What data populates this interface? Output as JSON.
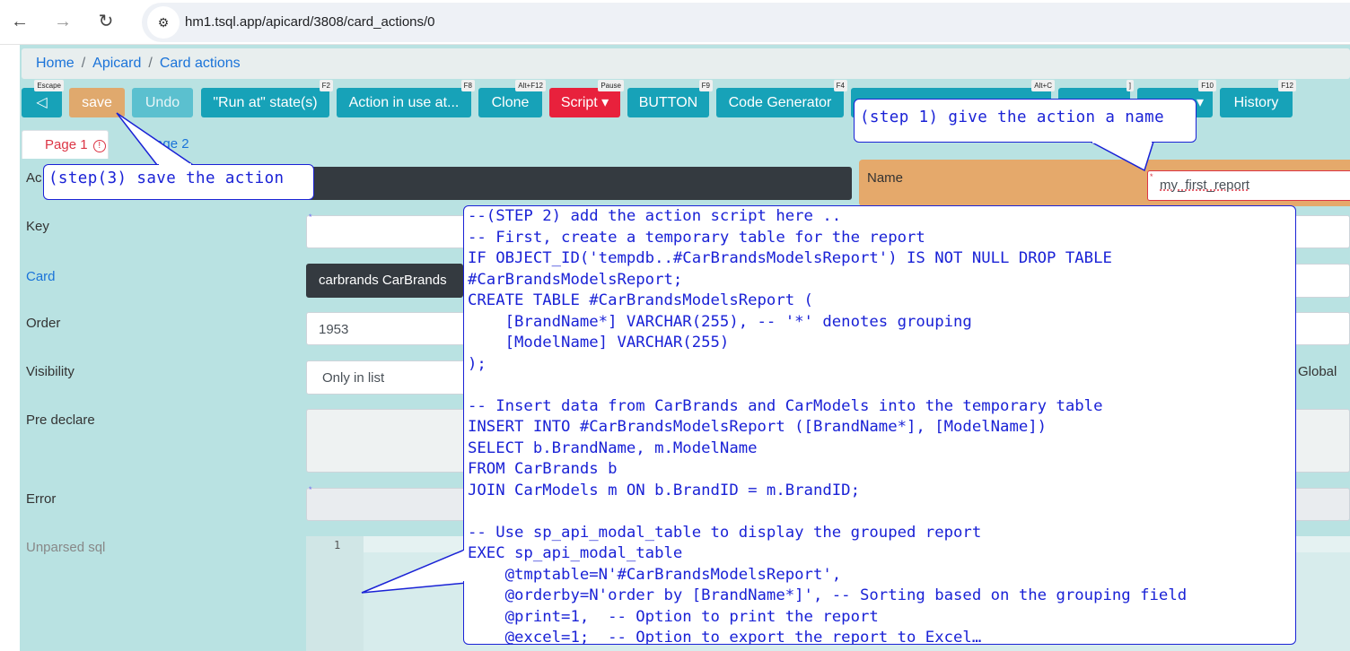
{
  "browser": {
    "url": "hm1.tsql.app/apicard/3808/card_actions/0",
    "back_icon": "←",
    "forward_icon": "→",
    "reload_icon": "↻",
    "site_info_icon": "⚙"
  },
  "breadcrumb": {
    "home": "Home",
    "apicard": "Apicard",
    "current": "Card actions",
    "sep": "/"
  },
  "toolbar": {
    "back_label": "◁",
    "back_key": "Escape",
    "save_label": "save",
    "undo_label": "Undo",
    "run_at_label": "\"Run at\" state(s)",
    "run_at_key": "F2",
    "action_in_use_label": "Action in use at...",
    "action_in_use_key": "F8",
    "clone_label": "Clone",
    "clone_key": "Alt+F12",
    "script_label": "Script ▾",
    "script_key": "Pause",
    "button_label": "BUTTON",
    "button_key": "F9",
    "code_gen_label": "Code Generator",
    "code_gen_key": "F4",
    "hidden1_key": "Alt+C",
    "hidden2_key": "]",
    "hidden3_label": "▾",
    "hidden3_key": "F10",
    "history_label": "History",
    "history_key": "F12"
  },
  "tabs": {
    "page1": "Page 1",
    "page1_alert": "!",
    "page2": "Page 2"
  },
  "form": {
    "action_label": "Ac",
    "name_label": "Name",
    "name_value": "my_first_report",
    "key_label": "Key",
    "card_label": "Card",
    "card_value": "carbrands CarBrands",
    "order_label": "Order",
    "order_value": "1953",
    "visibility_label": "Visibility",
    "visibility_value": "Only in list",
    "global_label": "Global",
    "pre_declare_label": "Pre declare",
    "error_label": "Error",
    "unparsed_sql_label": "Unparsed sql",
    "editor_line_no": "1",
    "required_mark": "*"
  },
  "callouts": {
    "step1": "(step 1) give the action a name",
    "step3": "(step(3) save the action",
    "step2_lines": [
      "--(STEP 2) add the action script here ..",
      "-- First, create a temporary table for the report",
      "IF OBJECT_ID('tempdb..#CarBrandsModelsReport') IS NOT NULL DROP TABLE",
      "#CarBrandsModelsReport;",
      "CREATE TABLE #CarBrandsModelsReport (",
      "    [BrandName*] VARCHAR(255), -- '*' denotes grouping",
      "    [ModelName] VARCHAR(255)",
      ");",
      "",
      "-- Insert data from CarBrands and CarModels into the temporary table",
      "INSERT INTO #CarBrandsModelsReport ([BrandName*], [ModelName])",
      "SELECT b.BrandName, m.ModelName",
      "FROM CarBrands b",
      "JOIN CarModels m ON b.BrandID = m.BrandID;",
      "",
      "-- Use sp_api_modal_table to display the grouped report",
      "EXEC sp_api_modal_table",
      "    @tmptable=N'#CarBrandsModelsReport',",
      "    @orderby=N'order by [BrandName*]', -- Sorting based on the grouping field",
      "    @print=1,  -- Option to print the report",
      "    @excel=1;  -- Option to export the report to Excel…"
    ]
  },
  "colors": {
    "app_bg": "#b9e2e2",
    "info": "#17a2b8",
    "save": "#e0a96d",
    "danger": "#dc3545",
    "dark": "#343a40",
    "callout": "#1a22d6",
    "name_panel": "#e5a96b"
  }
}
